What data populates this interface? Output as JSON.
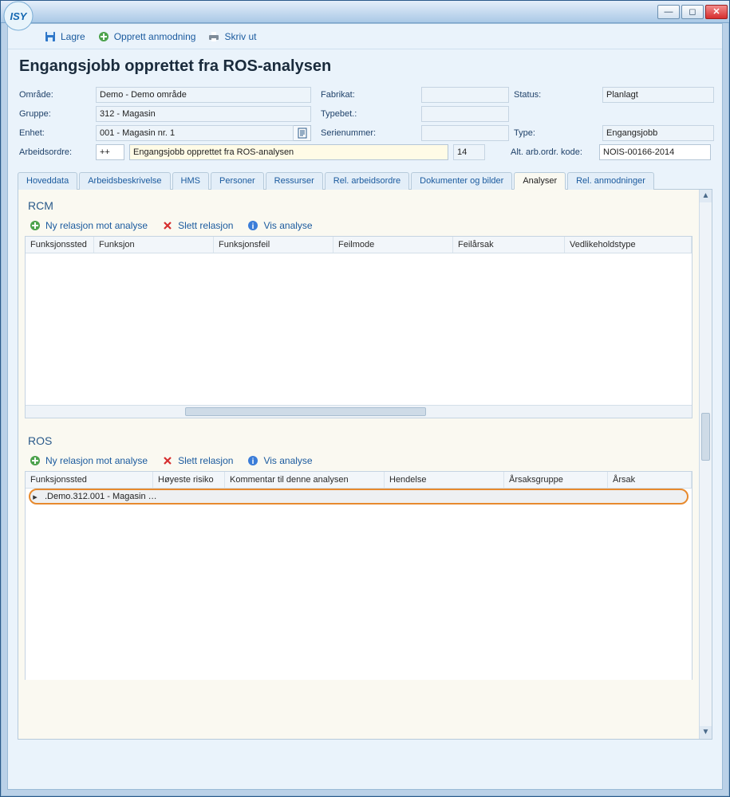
{
  "window": {
    "title_blank": ""
  },
  "toolbar": {
    "lagre": "Lagre",
    "opprett": "Opprett anmodning",
    "skriv_ut": "Skriv ut"
  },
  "page": {
    "title": "Engangsjobb opprettet fra ROS-analysen"
  },
  "form": {
    "omrade_label": "Område:",
    "omrade": "Demo - Demo område",
    "gruppe_label": "Gruppe:",
    "gruppe": "312 - Magasin",
    "enhet_label": "Enhet:",
    "enhet": "001 - Magasin nr. 1",
    "arbeidsordre_label": "Arbeidsordre:",
    "arbeidsordre_code": "++",
    "arbeidsordre_text": "Engangsjobb opprettet fra ROS-analysen",
    "arbeidsordre_num": "14",
    "fabrikat_label": "Fabrikat:",
    "fabrikat": "",
    "typebet_label": "Typebet.:",
    "typebet": "",
    "serienummer_label": "Serienummer:",
    "serienummer": "",
    "status_label": "Status:",
    "status": "Planlagt",
    "type_label": "Type:",
    "type": "Engangsjobb",
    "altkode_label": "Alt. arb.ordr. kode:",
    "altkode": "NOIS-00166-2014"
  },
  "tabs": [
    {
      "label": "Hoveddata"
    },
    {
      "label": "Arbeidsbeskrivelse"
    },
    {
      "label": "HMS"
    },
    {
      "label": "Personer"
    },
    {
      "label": "Ressurser"
    },
    {
      "label": "Rel. arbeidsordre"
    },
    {
      "label": "Dokumenter og bilder"
    },
    {
      "label": "Analyser",
      "active": true
    },
    {
      "label": "Rel. anmodninger"
    }
  ],
  "rcm": {
    "title": "RCM",
    "btn_new": "Ny relasjon mot analyse",
    "btn_del": "Slett relasjon",
    "btn_show": "Vis analyse",
    "columns": [
      "Funksjonssted",
      "Funksjon",
      "Funksjonsfeil",
      "Feilmode",
      "Feilårsak",
      "Vedlikeholdstype"
    ]
  },
  "ros": {
    "title": "ROS",
    "btn_new": "Ny relasjon mot analyse",
    "btn_del": "Slett relasjon",
    "btn_show": "Vis analyse",
    "columns": [
      "Funksjonssted",
      "Høyeste risiko",
      "Kommentar til denne analysen",
      "Hendelse",
      "Årsaksgruppe",
      "Årsak"
    ],
    "rows": [
      {
        "funksjonssted": ".Demo.312.001 - Magasin …",
        "risiko": "",
        "kommentar": "",
        "hendelse": "",
        "arsaksgruppe": "",
        "arsak": ""
      }
    ]
  }
}
